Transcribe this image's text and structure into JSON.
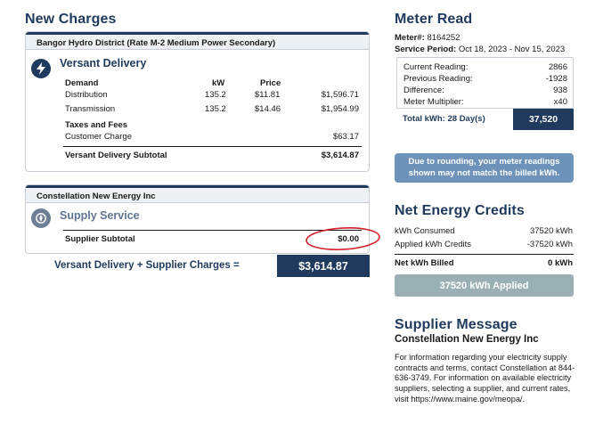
{
  "new_charges": {
    "title": "New Charges",
    "versant": {
      "header": "Bangor Hydro District (Rate M-2 Medium Power Secondary)",
      "title": "Versant Delivery",
      "col_demand": "Demand",
      "col_kw": "kW",
      "col_price": "Price",
      "rows": [
        {
          "label": "Distribution",
          "kw": "135.2",
          "price": "$11.81",
          "amount": "$1,596.71"
        },
        {
          "label": "Transmission",
          "kw": "135.2",
          "price": "$14.46",
          "amount": "$1,954.99"
        }
      ],
      "taxes_label": "Taxes and Fees",
      "customer_charge_label": "Customer Charge",
      "customer_charge_amount": "$63.17",
      "subtotal_label": "Versant Delivery Subtotal",
      "subtotal_amount": "$3,614.87"
    },
    "supplier": {
      "header": "Constellation New Energy Inc",
      "title": "Supply Service",
      "subtotal_label": "Supplier Subtotal",
      "subtotal_amount": "$0.00"
    },
    "total_label": "Versant Delivery + Supplier Charges =",
    "total_amount": "$3,614.87"
  },
  "meter_read": {
    "title": "Meter Read",
    "meter_label": "Meter#:",
    "meter_number": "8164252",
    "period_label": "Service Period:",
    "period_value": "Oct 18, 2023 - Nov 15, 2023",
    "rows": [
      {
        "label": "Current Reading:",
        "value": "2866"
      },
      {
        "label": "Previous Reading:",
        "value": "-1928"
      },
      {
        "label": "Difference:",
        "value": "938"
      },
      {
        "label": "Meter Multiplier:",
        "value": "x40"
      }
    ],
    "total_label": "Total kWh: 28 Day(s)",
    "total_value": "37,520",
    "rounding_note": "Due to rounding, your meter readings shown may not match the billed kWh."
  },
  "net_energy": {
    "title": "Net Energy Credits",
    "consumed_label": "kWh Consumed",
    "consumed_value": "37520 kWh",
    "applied_label": "Applied kWh Credits",
    "applied_value": "-37520 kWh",
    "billed_label": "Net kWh Billed",
    "billed_value": "0 kWh",
    "button_label": "37520 kWh Applied"
  },
  "supplier_message": {
    "title": "Supplier Message",
    "company": "Constellation New Energy Inc",
    "body": "For information regarding your electricity supply contracts and terms, contact Constellation at 844-636-3749. For information on available electricity suppliers, selecting a supplier, and current rates, visit https://www.maine.gov/meopa/."
  },
  "colors": {
    "navy": "#1f3a5c",
    "info_blue": "#6d93bb",
    "applied_gray": "#9bb0b5",
    "annotation_red": "#d0212a"
  }
}
